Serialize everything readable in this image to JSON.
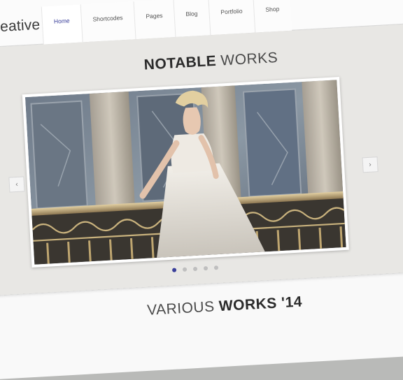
{
  "header": {
    "logo": "creative",
    "nav": [
      {
        "label": "Home",
        "active": true
      },
      {
        "label": "Shortcodes",
        "active": false
      },
      {
        "label": "Pages",
        "active": false
      },
      {
        "label": "Blog",
        "active": false
      },
      {
        "label": "Portfolio",
        "active": false
      },
      {
        "label": "Shop",
        "active": false
      }
    ]
  },
  "notable": {
    "title_strong": "NOTABLE",
    "title_light": "WORKS"
  },
  "slider": {
    "prev_icon": "chevron-left-icon",
    "next_icon": "chevron-right-icon",
    "slide_count": 5,
    "active_slide": 1
  },
  "various": {
    "title_light": "VARIOUS",
    "title_strong": "WORKS '14"
  },
  "colors": {
    "accent": "#3a3f9a",
    "background": "#e8e7e4",
    "header": "#fbfbfb"
  }
}
